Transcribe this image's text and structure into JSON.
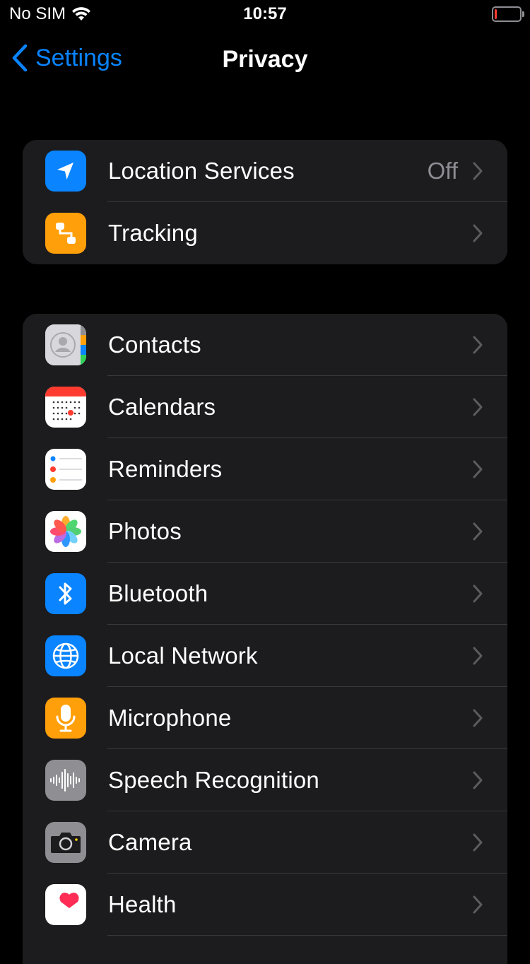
{
  "status_bar": {
    "carrier": "No SIM",
    "time": "10:57"
  },
  "nav": {
    "back_label": "Settings",
    "title": "Privacy"
  },
  "group1": [
    {
      "label": "Location Services",
      "value": "Off",
      "icon": "location-arrow-icon",
      "color": "#0a84ff"
    },
    {
      "label": "Tracking",
      "icon": "tracking-icon",
      "color": "#ff9f0a"
    }
  ],
  "group2": [
    {
      "label": "Contacts",
      "icon": "contacts-icon"
    },
    {
      "label": "Calendars",
      "icon": "calendar-icon"
    },
    {
      "label": "Reminders",
      "icon": "reminders-icon"
    },
    {
      "label": "Photos",
      "icon": "photos-icon"
    },
    {
      "label": "Bluetooth",
      "icon": "bluetooth-icon",
      "color": "#0a84ff"
    },
    {
      "label": "Local Network",
      "icon": "globe-icon",
      "color": "#0a84ff"
    },
    {
      "label": "Microphone",
      "icon": "microphone-icon",
      "color": "#ff9f0a"
    },
    {
      "label": "Speech Recognition",
      "icon": "waveform-icon",
      "color": "#8e8e93"
    },
    {
      "label": "Camera",
      "icon": "camera-icon",
      "color": "#8e8e93"
    },
    {
      "label": "Health",
      "icon": "heart-icon",
      "color": "#ffffff"
    }
  ]
}
